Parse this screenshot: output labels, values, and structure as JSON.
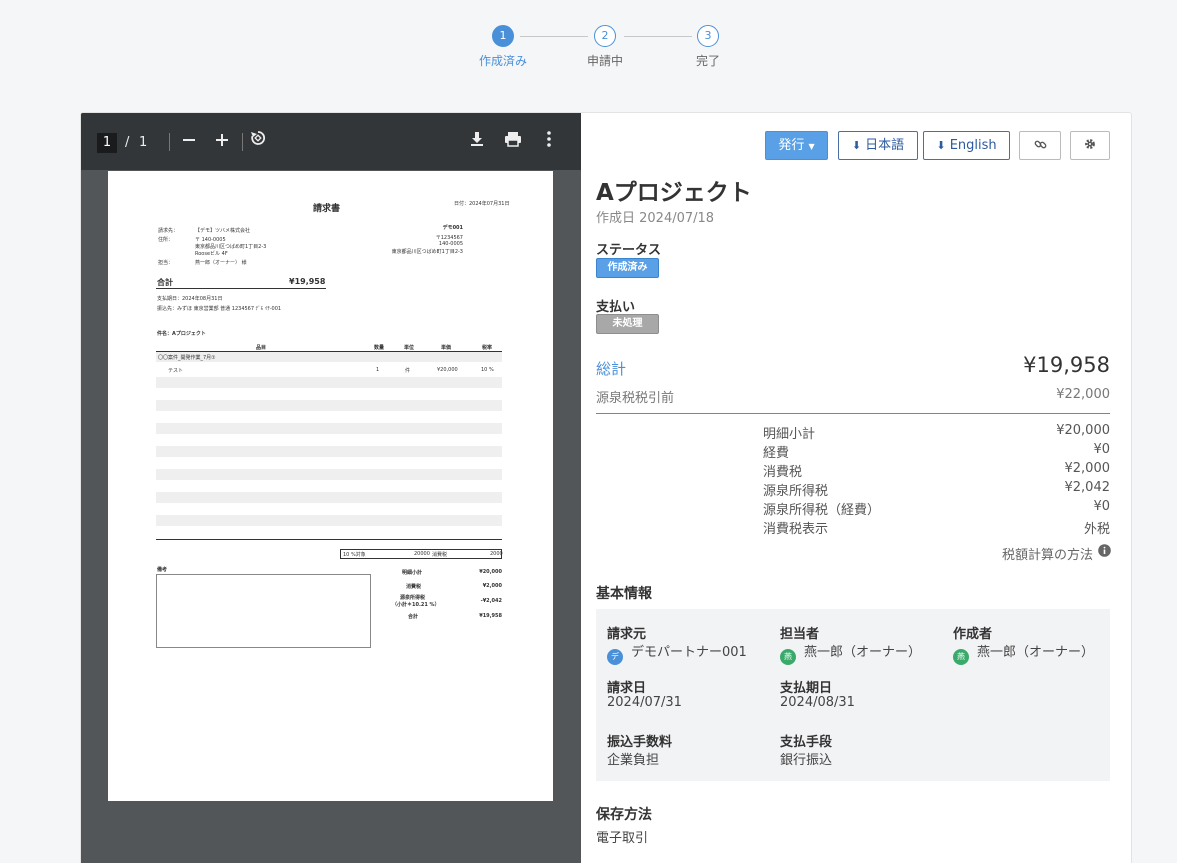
{
  "stepper": {
    "steps": [
      {
        "num": "1",
        "label": "作成済み"
      },
      {
        "num": "2",
        "label": "申請中"
      },
      {
        "num": "3",
        "label": "完了"
      }
    ]
  },
  "viewer": {
    "page_current": "1",
    "page_sep": "/",
    "page_total": "1"
  },
  "document": {
    "title": "請求書",
    "date": "日付：2024年07月31日",
    "to_label": "請求先：",
    "to_name": "【デモ】ツバメ株式会社",
    "addr_label": "住所：",
    "addr_1": "〒 140-0005",
    "addr_2": "東京都品川区つばめ町1丁目2-3",
    "addr_3": "Rooseビル 4F",
    "person_label": "担当：",
    "person_name": "燕一郎（オーナー） 様",
    "issuer_name": "デモ001",
    "issuer_zip": "〒1234567",
    "issuer_code": "140-0005",
    "issuer_addr": "東京都品川区つばめ町1丁目2-3",
    "total_label": "合計",
    "total_value": "¥19,958",
    "due": "支払期日：2024年08月31日",
    "bank": "振込先：みずほ 東京営業部 普通 1234567 ﾃﾞﾓ ｲﾁ-001",
    "subject": "件名：Aプロジェクト",
    "cols": [
      "品目",
      "数量",
      "単位",
      "単価",
      "税率"
    ],
    "group_row": "〇〇案件_開発作業_7月①",
    "item": {
      "name": "テスト",
      "qty": "1",
      "unit": "件",
      "price": "¥20,000",
      "tax": "10 %"
    },
    "tax_summary": {
      "label": "10 %対象",
      "amount": "20000",
      "tax_label": "消費税",
      "tax_amount": "2000"
    },
    "remarks_label": "備考",
    "sum_rows": [
      {
        "label": "明細小計",
        "value": "¥20,000"
      },
      {
        "label": "消費税",
        "value": "¥2,000"
      },
      {
        "label": "源泉所得税",
        "value": "-¥2,042"
      },
      {
        "label": "（小計＊10.21 %）",
        "value": ""
      },
      {
        "label": "合計",
        "value": "¥19,958"
      }
    ]
  },
  "actions": {
    "issue": "発行",
    "japanese": "日本語",
    "english": "English"
  },
  "header": {
    "title": "Aプロジェクト",
    "created": "作成日 2024/07/18"
  },
  "status": {
    "label": "ステータス",
    "value": "作成済み"
  },
  "payment": {
    "label": "支払い",
    "value": "未処理"
  },
  "totals": {
    "total_label": "総計",
    "total_value": "¥19,958",
    "pre_label": "源泉税税引前",
    "pre_value": "¥22,000",
    "breakdown": [
      {
        "label": "明細小計",
        "value": "¥20,000"
      },
      {
        "label": "経費",
        "value": "¥0"
      },
      {
        "label": "消費税",
        "value": "¥2,000"
      },
      {
        "label": "源泉所得税",
        "value": "¥2,042"
      },
      {
        "label": "源泉所得税（経費）",
        "value": "¥0"
      },
      {
        "label": "消費税表示",
        "value": "外税"
      }
    ],
    "tax_method": "税額計算の方法"
  },
  "basic": {
    "heading": "基本情報",
    "requester_label": "請求元",
    "requester_value": "デモパートナー001",
    "requester_avatar": "デ",
    "owner_label": "担当者",
    "owner_value": "燕一郎（オーナー）",
    "owner_avatar": "燕",
    "creator_label": "作成者",
    "creator_value": "燕一郎（オーナー）",
    "creator_avatar": "燕",
    "invoice_date_label": "請求日",
    "invoice_date_value": "2024/07/31",
    "due_label": "支払期日",
    "due_value": "2024/08/31",
    "fee_label": "振込手数料",
    "fee_value": "企業負担",
    "method_label": "支払手段",
    "method_value": "銀行振込"
  },
  "storage": {
    "label": "保存方法",
    "value": "電子取引"
  },
  "colors": {
    "accent": "#4a90d9",
    "primary_button": "#5aa0e6",
    "viewer_bg": "#525659",
    "viewer_toolbar": "#323639"
  }
}
